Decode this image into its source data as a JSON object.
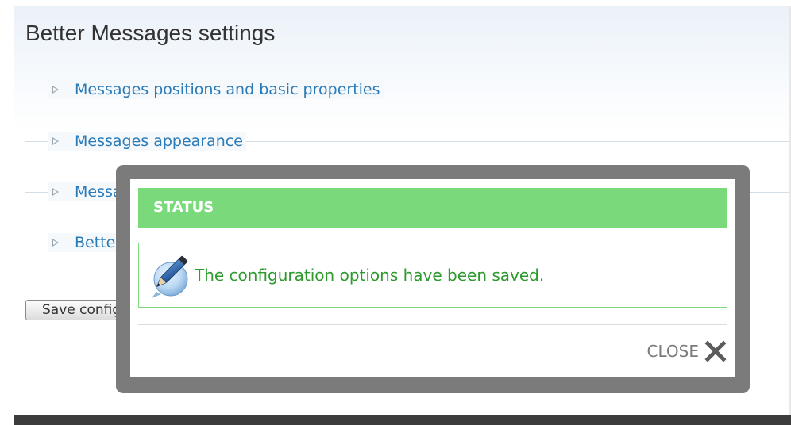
{
  "page": {
    "title": "Better Messages settings"
  },
  "fieldsets": [
    {
      "label": "Messages positions and basic properties"
    },
    {
      "label": "Messages appearance"
    },
    {
      "label": "Messages visibility"
    },
    {
      "label": "Better Messages permissions"
    }
  ],
  "form": {
    "save_label": "Save configuration"
  },
  "modal": {
    "status_label": "STATUS",
    "message": "The configuration options have been saved.",
    "close_label": "CLOSE",
    "icon": "pencil-icon",
    "close_icon": "close-icon"
  },
  "colors": {
    "link": "#2a7ab8",
    "status_green": "#7ad97a",
    "message_text": "#2c9a2c",
    "modal_frame": "#7b7b7b"
  }
}
